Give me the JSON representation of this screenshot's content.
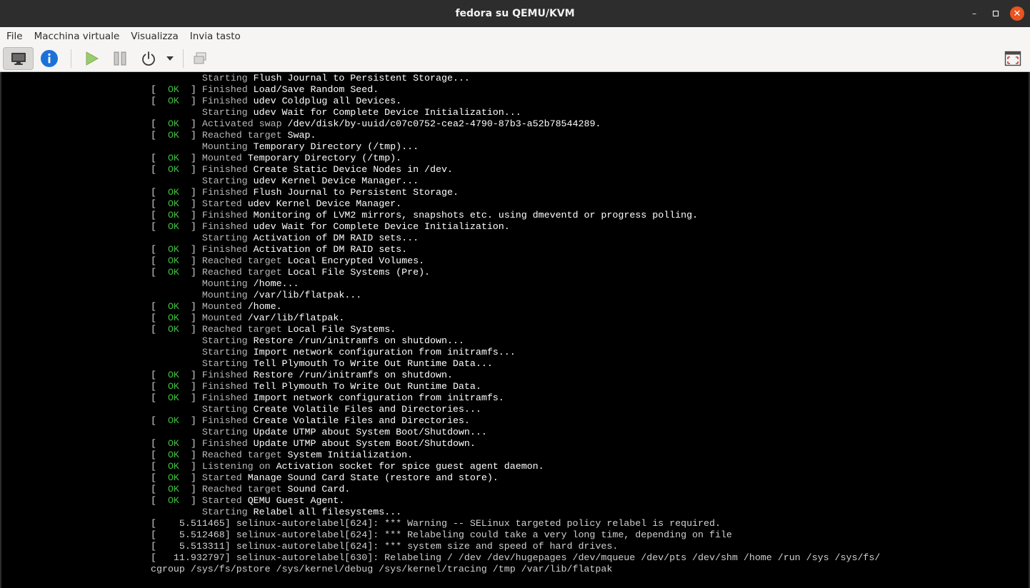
{
  "window": {
    "title": "fedora su QEMU/KVM",
    "minimize": "–",
    "maximize": "▫",
    "close": "✕"
  },
  "menu": [
    "File",
    "Macchina virtuale",
    "Visualizza",
    "Invia tasto"
  ],
  "toolbar": {
    "icons": [
      "display-icon",
      "info-icon",
      "play-icon",
      "pause-icon",
      "power-icon",
      "chevron-down-icon",
      "snapshot-icon",
      "fullscreen-icon"
    ],
    "accent": "#1c71d8"
  },
  "console": {
    "ok_text": "OK",
    "ok_color": "#3ec03e",
    "top_partial": "Starting Flush Journal to Persistent Storage...",
    "lines": [
      {
        "s": "",
        "l": "Starting",
        "t": "Flush Journal to Persistent Storage..."
      },
      {
        "s": "OK",
        "l": "Finished",
        "t": "Load/Save Random Seed."
      },
      {
        "s": "OK",
        "l": "Finished",
        "t": "udev Coldplug all Devices."
      },
      {
        "s": "",
        "l": "Starting",
        "t": "udev Wait for Complete Device Initialization..."
      },
      {
        "s": "OK",
        "l": "Activated swap",
        "t": "/dev/disk/by-uuid/c07c0752-cea2-4790-87b3-a52b78544289."
      },
      {
        "s": "OK",
        "l": "Reached target",
        "t": "Swap."
      },
      {
        "s": "",
        "l": "Mounting",
        "t": "Temporary Directory (/tmp)..."
      },
      {
        "s": "OK",
        "l": "Mounted",
        "t": "Temporary Directory (/tmp)."
      },
      {
        "s": "OK",
        "l": "Finished",
        "t": "Create Static Device Nodes in /dev."
      },
      {
        "s": "",
        "l": "Starting",
        "t": "udev Kernel Device Manager..."
      },
      {
        "s": "OK",
        "l": "Finished",
        "t": "Flush Journal to Persistent Storage."
      },
      {
        "s": "OK",
        "l": "Started",
        "t": "udev Kernel Device Manager."
      },
      {
        "s": "OK",
        "l": "Finished",
        "t": "Monitoring of LVM2 mirrors, snapshots etc. using dmeventd or progress polling."
      },
      {
        "s": "OK",
        "l": "Finished",
        "t": "udev Wait for Complete Device Initialization."
      },
      {
        "s": "",
        "l": "Starting",
        "t": "Activation of DM RAID sets..."
      },
      {
        "s": "OK",
        "l": "Finished",
        "t": "Activation of DM RAID sets."
      },
      {
        "s": "OK",
        "l": "Reached target",
        "t": "Local Encrypted Volumes."
      },
      {
        "s": "OK",
        "l": "Reached target",
        "t": "Local File Systems (Pre)."
      },
      {
        "s": "",
        "l": "Mounting",
        "t": "/home..."
      },
      {
        "s": "",
        "l": "Mounting",
        "t": "/var/lib/flatpak..."
      },
      {
        "s": "OK",
        "l": "Mounted",
        "t": "/home."
      },
      {
        "s": "OK",
        "l": "Mounted",
        "t": "/var/lib/flatpak."
      },
      {
        "s": "OK",
        "l": "Reached target",
        "t": "Local File Systems."
      },
      {
        "s": "",
        "l": "Starting",
        "t": "Restore /run/initramfs on shutdown..."
      },
      {
        "s": "",
        "l": "Starting",
        "t": "Import network configuration from initramfs..."
      },
      {
        "s": "",
        "l": "Starting",
        "t": "Tell Plymouth To Write Out Runtime Data..."
      },
      {
        "s": "OK",
        "l": "Finished",
        "t": "Restore /run/initramfs on shutdown."
      },
      {
        "s": "OK",
        "l": "Finished",
        "t": "Tell Plymouth To Write Out Runtime Data."
      },
      {
        "s": "OK",
        "l": "Finished",
        "t": "Import network configuration from initramfs."
      },
      {
        "s": "",
        "l": "Starting",
        "t": "Create Volatile Files and Directories..."
      },
      {
        "s": "OK",
        "l": "Finished",
        "t": "Create Volatile Files and Directories."
      },
      {
        "s": "",
        "l": "Starting",
        "t": "Update UTMP about System Boot/Shutdown..."
      },
      {
        "s": "OK",
        "l": "Finished",
        "t": "Update UTMP about System Boot/Shutdown."
      },
      {
        "s": "OK",
        "l": "Reached target",
        "t": "System Initialization."
      },
      {
        "s": "OK",
        "l": "Listening on",
        "t": "Activation socket for spice guest agent daemon."
      },
      {
        "s": "OK",
        "l": "Started",
        "t": "Manage Sound Card State (restore and store)."
      },
      {
        "s": "OK",
        "l": "Reached target",
        "t": "Sound Card."
      },
      {
        "s": "OK",
        "l": "Started",
        "t": "QEMU Guest Agent."
      },
      {
        "s": "",
        "l": "Starting",
        "t": "Relabel all filesystems..."
      }
    ],
    "kernel_lines": [
      "[    5.511465] selinux-autorelabel[624]: *** Warning -- SELinux targeted policy relabel is required.",
      "[    5.512468] selinux-autorelabel[624]: *** Relabeling could take a very long time, depending on file",
      "[    5.513311] selinux-autorelabel[624]: *** system size and speed of hard drives.",
      "[   11.932797] selinux-autorelabel[630]: Relabeling / /dev /dev/hugepages /dev/mqueue /dev/pts /dev/shm /home /run /sys /sys/fs/",
      "cgroup /sys/fs/pstore /sys/kernel/debug /sys/kernel/tracing /tmp /var/lib/flatpak"
    ]
  }
}
